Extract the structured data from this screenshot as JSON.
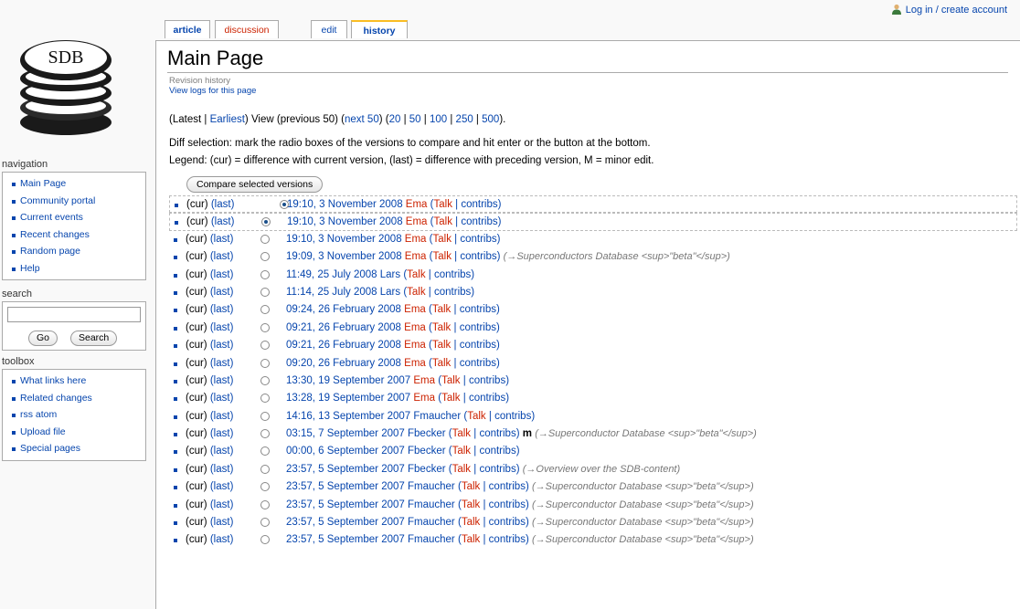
{
  "personal": {
    "login": "Log in / create account"
  },
  "logo": {
    "text": "SDB"
  },
  "tabs": {
    "article": "article",
    "discussion": "discussion",
    "edit": "edit",
    "history": "history"
  },
  "page": {
    "title": "Main Page",
    "subtitle": "Revision history",
    "logs_link": "View logs for this page"
  },
  "nav": {
    "open": "(",
    "latest": "Latest",
    "sep1": " | ",
    "earliest": "Earliest",
    "view": ") View (previous 50) (",
    "next": "next 50",
    "mid": ") (",
    "n20": "20",
    "n50": "50",
    "n100": "100",
    "n250": "250",
    "n500": "500",
    "close": ")."
  },
  "diff_selection": "Diff selection: mark the radio boxes of the versions to compare and hit enter or the button at the bottom.",
  "legend": "Legend: (cur) = difference with current version, (last) = difference with preceding version, M = minor edit.",
  "compare_button": "Compare selected versions",
  "sidebar": {
    "navigation": {
      "title": "navigation",
      "items": [
        "Main Page",
        "Community portal",
        "Current events",
        "Recent changes",
        "Random page",
        "Help"
      ]
    },
    "search": {
      "title": "search",
      "go": "Go",
      "search": "Search"
    },
    "toolbox": {
      "title": "toolbox",
      "items": [
        "What links here",
        "Related changes",
        "rss  atom",
        "Upload file",
        "Special pages"
      ]
    }
  },
  "history": [
    {
      "date": "19:10, 3 November 2008",
      "user": "Ema",
      "user_red": true,
      "minor": "",
      "summary": "",
      "radio": "first"
    },
    {
      "date": "19:10, 3 November 2008",
      "user": "Ema",
      "user_red": true,
      "minor": "",
      "summary": "",
      "radio": "second"
    },
    {
      "date": "19:10, 3 November 2008",
      "user": "Ema",
      "user_red": true,
      "minor": "",
      "summary": "",
      "radio": "off"
    },
    {
      "date": "19:09, 3 November 2008",
      "user": "Ema",
      "user_red": true,
      "minor": "",
      "summary": "(→Superconductors Database <sup>\"beta\"</sup>)",
      "radio": "off"
    },
    {
      "date": "11:49, 25 July 2008",
      "user": "Lars",
      "user_red": false,
      "minor": "",
      "summary": "",
      "radio": "off"
    },
    {
      "date": "11:14, 25 July 2008",
      "user": "Lars",
      "user_red": false,
      "minor": "",
      "summary": "",
      "radio": "off"
    },
    {
      "date": "09:24, 26 February 2008",
      "user": "Ema",
      "user_red": true,
      "minor": "",
      "summary": "",
      "radio": "off"
    },
    {
      "date": "09:21, 26 February 2008",
      "user": "Ema",
      "user_red": true,
      "minor": "",
      "summary": "",
      "radio": "off"
    },
    {
      "date": "09:21, 26 February 2008",
      "user": "Ema",
      "user_red": true,
      "minor": "",
      "summary": "",
      "radio": "off"
    },
    {
      "date": "09:20, 26 February 2008",
      "user": "Ema",
      "user_red": true,
      "minor": "",
      "summary": "",
      "radio": "off"
    },
    {
      "date": "13:30, 19 September 2007",
      "user": "Ema",
      "user_red": true,
      "minor": "",
      "summary": "",
      "radio": "off"
    },
    {
      "date": "13:28, 19 September 2007",
      "user": "Ema",
      "user_red": true,
      "minor": "",
      "summary": "",
      "radio": "off"
    },
    {
      "date": "14:16, 13 September 2007",
      "user": "Fmaucher",
      "user_red": false,
      "minor": "",
      "summary": "",
      "radio": "off"
    },
    {
      "date": "03:15, 7 September 2007",
      "user": "Fbecker",
      "user_red": false,
      "minor": "m",
      "summary": "(→Superconductor Database <sup>\"beta\"</sup>)",
      "radio": "off"
    },
    {
      "date": "00:00, 6 September 2007",
      "user": "Fbecker",
      "user_red": false,
      "minor": "",
      "summary": "",
      "radio": "off"
    },
    {
      "date": "23:57, 5 September 2007",
      "user": "Fbecker",
      "user_red": false,
      "minor": "",
      "summary": "(→Overview over the SDB-content)",
      "radio": "off"
    },
    {
      "date": "23:57, 5 September 2007",
      "user": "Fmaucher",
      "user_red": false,
      "minor": "",
      "summary": "(→Superconductor Database <sup>\"beta\"</sup>)",
      "radio": "off"
    },
    {
      "date": "23:57, 5 September 2007",
      "user": "Fmaucher",
      "user_red": false,
      "minor": "",
      "summary": "(→Superconductor Database <sup>\"beta\"</sup>)",
      "radio": "off"
    },
    {
      "date": "23:57, 5 September 2007",
      "user": "Fmaucher",
      "user_red": false,
      "minor": "",
      "summary": "(→Superconductor Database <sup>\"beta\"</sup>)",
      "radio": "off"
    },
    {
      "date": "23:57, 5 September 2007",
      "user": "Fmaucher",
      "user_red": false,
      "minor": "",
      "summary": "(→Superconductor Database <sup>\"beta\"</sup>)",
      "radio": "off"
    }
  ],
  "row_labels": {
    "cur": "(cur)",
    "last": "(last)",
    "talk": "Talk",
    "contribs": "contribs"
  }
}
